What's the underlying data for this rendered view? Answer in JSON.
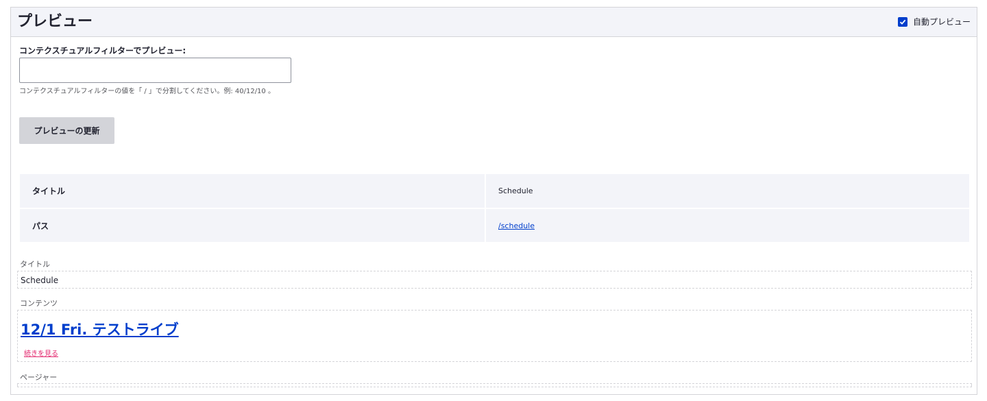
{
  "panel": {
    "title": "プレビュー",
    "auto_preview": {
      "label": "自動プレビュー",
      "checked": true
    }
  },
  "contextual_filter": {
    "label": "コンテクスチュアルフィルターでプレビュー:",
    "value": "",
    "help": "コンテクスチュアルフィルターの値を「 / 」で分割してください。例: 40/12/10 。"
  },
  "update_button": {
    "label": "プレビューの更新"
  },
  "info_table": {
    "rows": [
      {
        "key": "タイトル",
        "value": "Schedule"
      },
      {
        "key": "パス",
        "value": "/schedule"
      }
    ]
  },
  "fields": {
    "title": {
      "label": "タイトル",
      "value": "Schedule"
    },
    "content": {
      "label": "コンテンツ",
      "heading": "12/1 Fri. テストライブ",
      "read_more": "続きを見る"
    },
    "pager": {
      "label": "ページャー"
    }
  },
  "colors": {
    "accent": "#003ecc",
    "link_pink": "#e3286e",
    "header_bg": "#f3f4f9"
  }
}
